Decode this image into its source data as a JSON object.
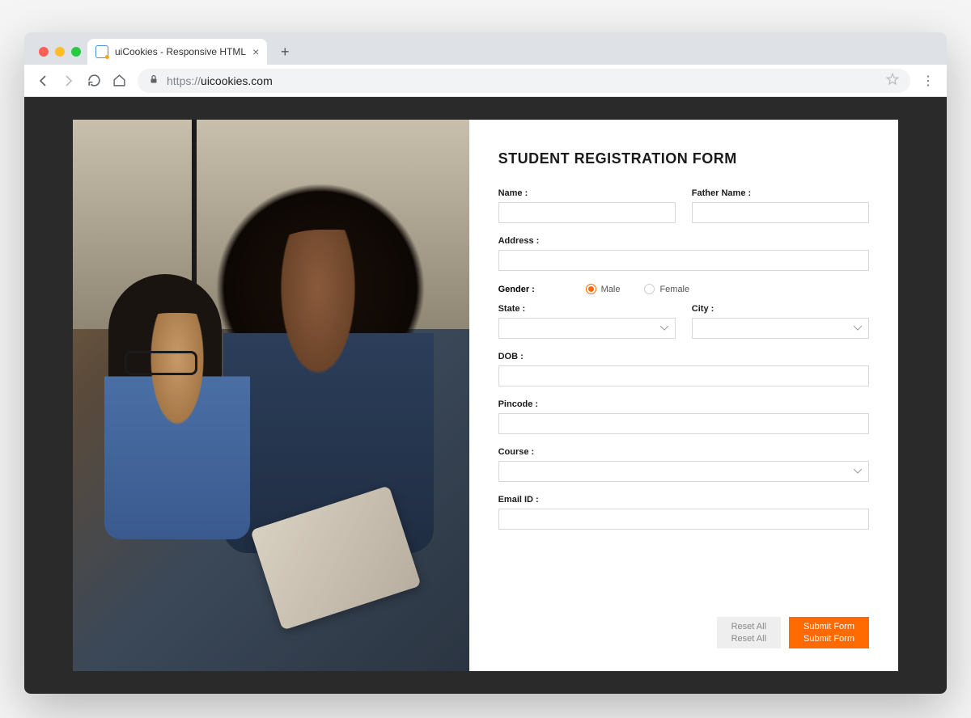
{
  "browser": {
    "tab_title": "uiCookies - Responsive HTML",
    "url_protocol": "https://",
    "url_domain": "uicookies.com"
  },
  "form": {
    "title": "STUDENT REGISTRATION FORM",
    "labels": {
      "name": "Name :",
      "father_name": "Father Name :",
      "address": "Address :",
      "gender": "Gender :",
      "state": "State :",
      "city": "City :",
      "dob": "DOB :",
      "pincode": "Pincode :",
      "course": "Course :",
      "email": "Email ID :"
    },
    "gender_options": {
      "male": "Male",
      "female": "Female",
      "selected": "male"
    },
    "buttons": {
      "reset_line1": "Reset All",
      "reset_line2": "Reset All",
      "submit_line1": "Submit Form",
      "submit_line2": "Submit Form"
    }
  },
  "colors": {
    "accent": "#ff6b00",
    "page_bg": "#2a2a2a"
  }
}
